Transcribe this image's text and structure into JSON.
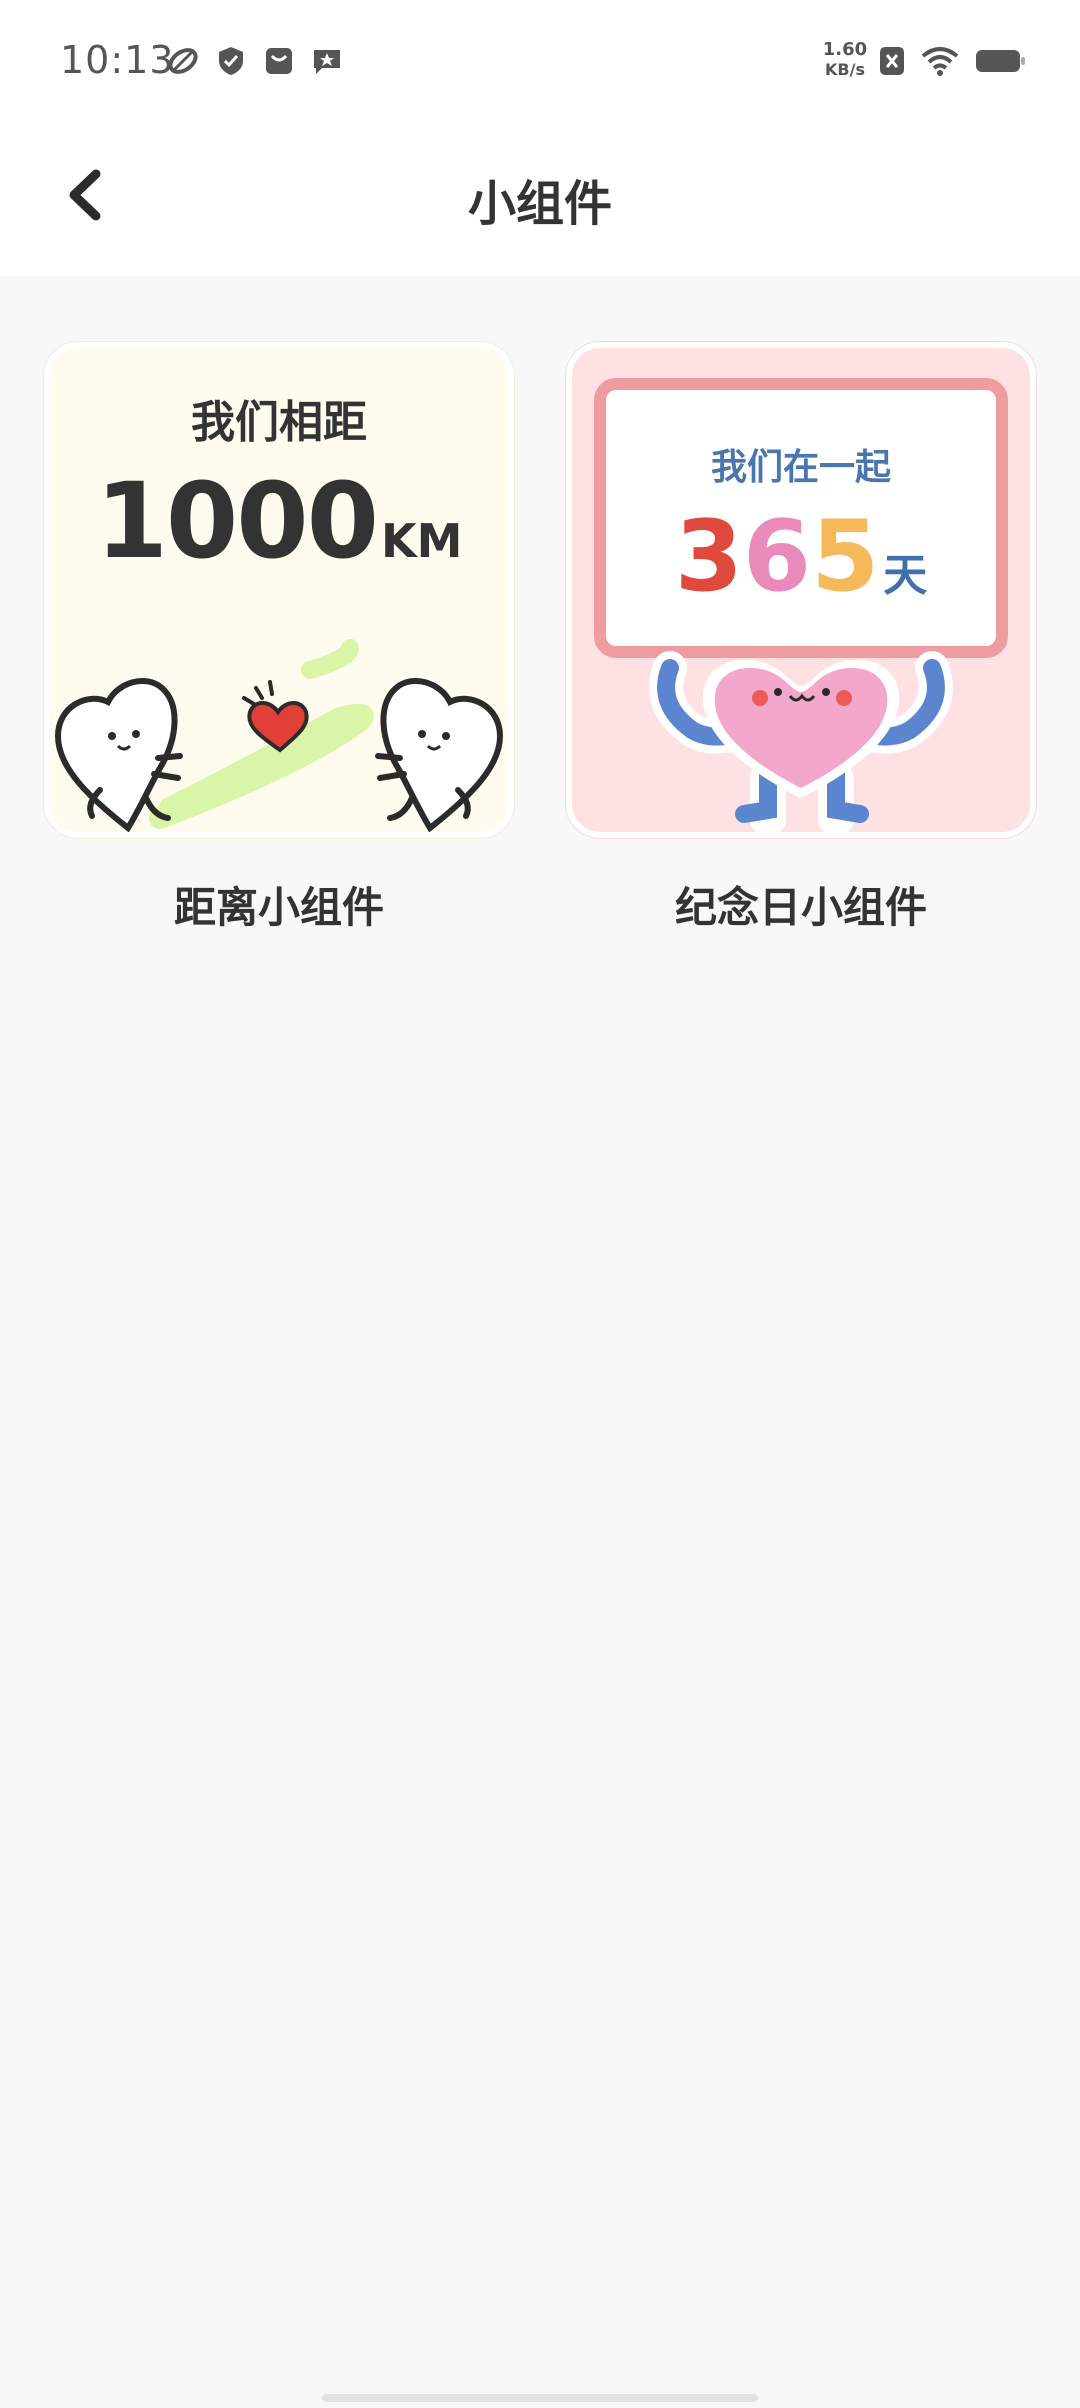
{
  "status_bar": {
    "time": "10:13",
    "net_speed_value": "1.60",
    "net_speed_unit": "KB/s",
    "icons_left": [
      "leaf-icon",
      "shield-icon",
      "mailbox-icon",
      "star-message-icon"
    ],
    "icons_right": [
      "close-box-icon",
      "wifi-icon",
      "battery-icon"
    ]
  },
  "header": {
    "title": "小组件",
    "back_icon": "chevron-left-icon"
  },
  "widgets": [
    {
      "label": "我们相距",
      "value": "1000",
      "unit": "KM",
      "caption": "距离小组件"
    },
    {
      "label": "我们在一起",
      "digits": [
        "3",
        "6",
        "5"
      ],
      "unit": "天",
      "caption": "纪念日小组件"
    }
  ],
  "colors": {
    "distance_bg": "#fffbee",
    "anniv_bg": "#ffe1e4",
    "anniv_border": "#ef9ca1",
    "digit_3": "#e04a3e",
    "digit_6": "#e98ab8",
    "digit_5": "#f6b95a",
    "anniv_text": "#4a76b0"
  }
}
